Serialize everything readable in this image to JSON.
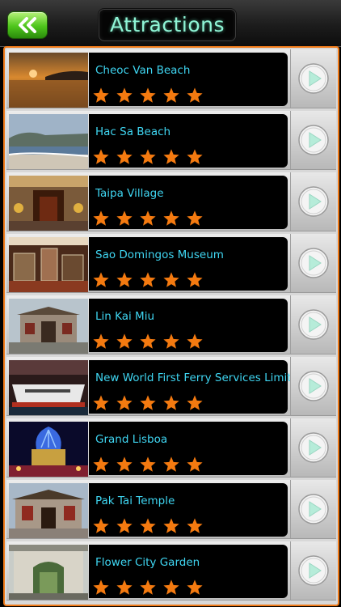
{
  "header": {
    "title": "Attractions",
    "back_icon": "double-chevron-left-icon"
  },
  "colors": {
    "accent": "#f07a18",
    "title_text": "#8ff5d6",
    "item_text": "#3fd6f2",
    "star": "#f47a10",
    "back_button": "#4ec51b"
  },
  "attractions": [
    {
      "name": "Cheoc Van Beach",
      "rating": 5
    },
    {
      "name": "Hac Sa Beach",
      "rating": 5
    },
    {
      "name": "Taipa Village",
      "rating": 5
    },
    {
      "name": "Sao Domingos Museum",
      "rating": 5
    },
    {
      "name": "Lin Kai Miu",
      "rating": 5
    },
    {
      "name": "New World First Ferry Services Limited",
      "rating": 5
    },
    {
      "name": "Grand Lisboa",
      "rating": 5
    },
    {
      "name": "Pak Tai Temple",
      "rating": 5
    },
    {
      "name": "Flower City Garden",
      "rating": 5
    }
  ]
}
